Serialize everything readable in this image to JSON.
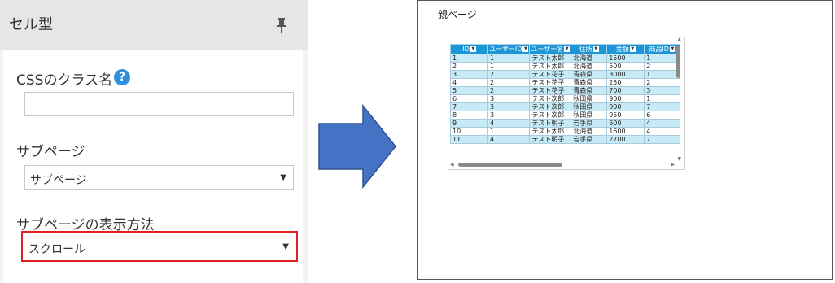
{
  "panel": {
    "title": "セル型",
    "fields": {
      "css_class_label": "CSSのクラス名",
      "css_class_value": "",
      "subpage_label": "サブページ",
      "subpage_value": "サブページ",
      "display_mode_label": "サブページの表示方法",
      "display_mode_value": "スクロール"
    }
  },
  "preview": {
    "page_title": "親ページ",
    "grid": {
      "columns": [
        "ID",
        "ユーザーID",
        "ユーザー名",
        "住所",
        "金額",
        "商品ID"
      ],
      "rows": [
        [
          "1",
          "1",
          "テスト太郎",
          "北海道",
          "1500",
          "1"
        ],
        [
          "2",
          "1",
          "テスト太郎",
          "北海道",
          "500",
          "2"
        ],
        [
          "3",
          "2",
          "テスト花子",
          "青森県",
          "3000",
          "1"
        ],
        [
          "4",
          "2",
          "テスト花子",
          "青森県",
          "250",
          "2"
        ],
        [
          "5",
          "2",
          "テスト花子",
          "青森県",
          "700",
          "3"
        ],
        [
          "6",
          "3",
          "テスト次郎",
          "秋田県",
          "900",
          "1"
        ],
        [
          "7",
          "3",
          "テスト次郎",
          "秋田県",
          "900",
          "7"
        ],
        [
          "8",
          "3",
          "テスト次郎",
          "秋田県",
          "950",
          "6"
        ],
        [
          "9",
          "4",
          "テスト明子",
          "岩手県",
          "600",
          "4"
        ],
        [
          "10",
          "1",
          "テスト太郎",
          "北海道",
          "1600",
          "4"
        ],
        [
          "11",
          "4",
          "テスト明子",
          "岩手県",
          "2700",
          "7"
        ]
      ]
    }
  },
  "colors": {
    "grid_header": "#1d96d6",
    "grid_alt_row": "#c7eaf7",
    "highlight_border": "#e02020",
    "arrow_fill": "#4472c4",
    "help_icon": "#2f8fdd"
  }
}
